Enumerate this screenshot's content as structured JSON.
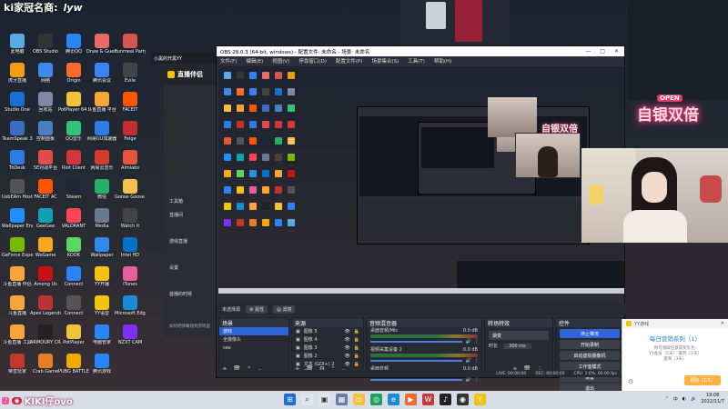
{
  "banner": {
    "title": "ki家冠名商:",
    "brand": "lyw"
  },
  "desktop_icons": [
    {
      "label": "此电脑",
      "color": "#5aa9e6"
    },
    {
      "label": "OBS Studio",
      "color": "#333"
    },
    {
      "label": "腾讯QQ",
      "color": "#2b84f5"
    },
    {
      "label": "Draw & Guess",
      "color": "#e86b6b"
    },
    {
      "label": "Funmeal Party",
      "color": "#d9534f"
    },
    {
      "label": "虎牙直播",
      "color": "#f39c12"
    },
    {
      "label": "网络",
      "color": "#3c8ce7"
    },
    {
      "label": "Origin",
      "color": "#f56c2d"
    },
    {
      "label": "腾讯会议",
      "color": "#3b82f6"
    },
    {
      "label": "Evile",
      "color": "#444"
    },
    {
      "label": "Studio One",
      "color": "#1a6fd4"
    },
    {
      "label": "回收站",
      "color": "#7a8aa6"
    },
    {
      "label": "PotPlayer 64 bit",
      "color": "#f0c33a"
    },
    {
      "label": "斗鱼直播 平台",
      "color": "#f7a53a"
    },
    {
      "label": "FACEIT",
      "color": "#ff5500"
    },
    {
      "label": "TeamSpeak 3",
      "color": "#3a6fbf"
    },
    {
      "label": "控制面板",
      "color": "#4a7fc1"
    },
    {
      "label": "QQ音乐",
      "color": "#31c27c"
    },
    {
      "label": "网易UU加速器",
      "color": "#2d7be5"
    },
    {
      "label": "Feige",
      "color": "#c22f2f"
    },
    {
      "label": "ToDesk",
      "color": "#2f7ae5"
    },
    {
      "label": "5E对战平台",
      "color": "#e04b4b"
    },
    {
      "label": "Riot Client",
      "color": "#d13639"
    },
    {
      "label": "网易云音乐",
      "color": "#d43c33"
    },
    {
      "label": "Aimlabs",
      "color": "#e4553a"
    },
    {
      "label": "UsbEAm Hosts Editor",
      "color": "#555"
    },
    {
      "label": "FACEIT AC",
      "color": "#ff5500"
    },
    {
      "label": "Steam",
      "color": "#1b2838"
    },
    {
      "label": "微信",
      "color": "#2aae67"
    },
    {
      "label": "Goose Goose Duck",
      "color": "#f2c14e"
    },
    {
      "label": "Wallpaper Engine",
      "color": "#1e90ff"
    },
    {
      "label": "GeeGee",
      "color": "#0fa3b1"
    },
    {
      "label": "VALORANT",
      "color": "#fd4556"
    },
    {
      "label": "Media",
      "color": "#6b7a8f"
    },
    {
      "label": "Watch It",
      "color": "#444"
    },
    {
      "label": "GeForce Experience",
      "color": "#76b900"
    },
    {
      "label": "WeGame",
      "color": "#f5a623"
    },
    {
      "label": "KOOK",
      "color": "#5cd65c"
    },
    {
      "label": "Wallpaper",
      "color": "#2e8be6"
    },
    {
      "label": "Intel HD",
      "color": "#0071c5"
    },
    {
      "label": "斗鱼直播 伴侣",
      "color": "#f7a53a"
    },
    {
      "label": "Among Us",
      "color": "#c51111"
    },
    {
      "label": "Connect",
      "color": "#2b84f5"
    },
    {
      "label": "YY开播",
      "color": "#f1c40f"
    },
    {
      "label": "iTunes",
      "color": "#e85d9e"
    },
    {
      "label": "斗鱼直播",
      "color": "#f7a53a"
    },
    {
      "label": "Apex Legends",
      "color": "#b93333"
    },
    {
      "label": "Connect",
      "color": "#555"
    },
    {
      "label": "YY语音",
      "color": "#f1c40f"
    },
    {
      "label": "Microsoft Edge",
      "color": "#1a8bd4"
    },
    {
      "label": "斗鱼直播 工具",
      "color": "#f7a53a"
    },
    {
      "label": "ARMOURY CRATE",
      "color": "#222"
    },
    {
      "label": "PotPlayer",
      "color": "#f0c33a"
    },
    {
      "label": "电脑管家",
      "color": "#2b84f5"
    },
    {
      "label": "NZXT CAM",
      "color": "#7b2ff7"
    },
    {
      "label": "帝皇玩家",
      "color": "#c0392b"
    },
    {
      "label": "Crab Game",
      "color": "#e67e22"
    },
    {
      "label": "PUBG BATTLEGR...",
      "color": "#f2a900"
    },
    {
      "label": "腾讯游戏",
      "color": "#2b84f5"
    }
  ],
  "companion": {
    "title": "直播伴侣",
    "tab_top": "小黑的开黑YY",
    "items": [
      "工具箱",
      "直播间",
      "游戏直播",
      "设置"
    ],
    "bottom_item": "首播的时候",
    "footer": "如何把弹幕放到游戏里"
  },
  "obs": {
    "title": "OBS 28.0.3 (64-bit, windows) - 配置文件: 未命名 - 场景: 未命名",
    "menu": [
      "文件(F)",
      "编辑(E)",
      "视图(V)",
      "停靠窗口(D)",
      "配置文件(P)",
      "场景集合(S)",
      "工具(T)",
      "帮助(H)"
    ],
    "scene_bar_label": "未选择源",
    "scene_bar_props": "属性",
    "scene_bar_filters": "滤镜",
    "scenes_title": "场景",
    "scenes": [
      "游戏",
      "全摄像头",
      "see"
    ],
    "sources_title": "来源",
    "sources": [
      "图像 5",
      "图像 4",
      "图像 3",
      "图像 2",
      "文本 (GDI+) 2",
      "图像"
    ],
    "mixer_title": "音频混音器",
    "mixer": [
      {
        "name": "桌面音频/Mic",
        "db": "0.0 dB"
      },
      {
        "name": "视频采集设备 2",
        "db": "0.0 dB"
      },
      {
        "name": "桌面音频",
        "db": "0.0 dB"
      }
    ],
    "transitions_title": "转场特效",
    "transition_value": "渐变",
    "duration_label": "时长",
    "duration_value": "300 ms",
    "controls_title": "控件",
    "controls": [
      "停止推流",
      "开始录制",
      "启动虚拟摄像机",
      "工作室模式",
      "设置",
      "退出"
    ],
    "status": {
      "live": "LIVE: 00:00:00",
      "rec": "REC: 00:00:00",
      "cpu": "CPU: 1.0%, 60.00 fps"
    }
  },
  "overlay": {
    "neon_text": "自银双倍",
    "open_text": "OPEN",
    "streamer_name": "KIKI仔ovo"
  },
  "notification": {
    "app": "YY游戏",
    "title": "每日营销系列（1）",
    "subtitle": "你可领取任意获奖礼包:",
    "line1": "YY会员（5天）   豪鸽（2天）",
    "line2": "座驾（3天）",
    "button": "领取（1/1）"
  },
  "taskbar": {
    "lang": "中",
    "time": "19:08",
    "date": "2022/11/7"
  }
}
